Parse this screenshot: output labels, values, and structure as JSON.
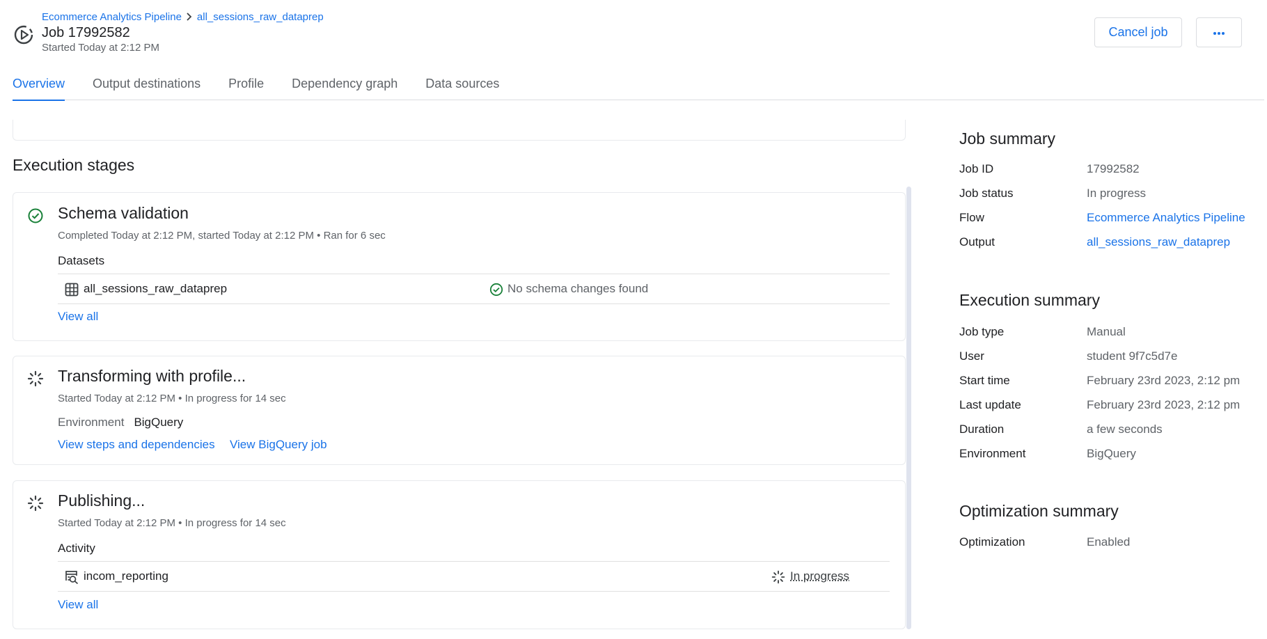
{
  "header": {
    "breadcrumb": {
      "flow": "Ecommerce Analytics Pipeline",
      "output": "all_sessions_raw_dataprep"
    },
    "title": "Job 17992582",
    "started": "Started Today at 2:12 PM",
    "cancel_label": "Cancel job",
    "more_label": "•••"
  },
  "tabs": [
    {
      "label": "Overview",
      "active": true
    },
    {
      "label": "Output destinations"
    },
    {
      "label": "Profile"
    },
    {
      "label": "Dependency graph"
    },
    {
      "label": "Data sources"
    }
  ],
  "execution": {
    "heading": "Execution stages",
    "stages": [
      {
        "title": "Schema validation",
        "subtitle": "Completed Today at 2:12 PM, started Today at 2:12 PM • Ran for 6 sec",
        "section_label": "Datasets",
        "row": {
          "name": "all_sessions_raw_dataprep",
          "status": "No schema changes found"
        },
        "link": "View all",
        "icon": "check-circle-icon",
        "status_color": "#188038"
      },
      {
        "title": "Transforming with profile...",
        "subtitle": "Started Today at 2:12 PM • In progress for 14 sec",
        "env_label": "Environment",
        "env_value": "BigQuery",
        "links": [
          "View steps and dependencies",
          "View BigQuery job"
        ],
        "icon": "spinner-icon"
      },
      {
        "title": "Publishing...",
        "subtitle": "Started Today at 2:12 PM • In progress for 14 sec",
        "section_label": "Activity",
        "row": {
          "name": "incom_reporting",
          "status": "In progress"
        },
        "link": "View all",
        "icon": "spinner-icon"
      }
    ]
  },
  "job_summary": {
    "heading": "Job summary",
    "rows": [
      {
        "key": "Job ID",
        "value": "17992582"
      },
      {
        "key": "Job status",
        "value": "In progress"
      },
      {
        "key": "Flow",
        "value": "Ecommerce Analytics Pipeline",
        "link": true
      },
      {
        "key": "Output",
        "value": "all_sessions_raw_dataprep",
        "link": true
      }
    ]
  },
  "execution_summary": {
    "heading": "Execution summary",
    "rows": [
      {
        "key": "Job type",
        "value": "Manual"
      },
      {
        "key": "User",
        "value": "student 9f7c5d7e"
      },
      {
        "key": "Start time",
        "value": "February 23rd 2023, 2:12 pm"
      },
      {
        "key": "Last update",
        "value": "February 23rd 2023, 2:12 pm"
      },
      {
        "key": "Duration",
        "value": "a few seconds"
      },
      {
        "key": "Environment",
        "value": "BigQuery"
      }
    ]
  },
  "optimization_summary": {
    "heading": "Optimization summary",
    "rows": [
      {
        "key": "Optimization",
        "value": "Enabled"
      }
    ]
  },
  "colors": {
    "accent": "#1a73e8",
    "success": "#188038",
    "muted_text": "#5f6368",
    "border": "#dadce0"
  }
}
